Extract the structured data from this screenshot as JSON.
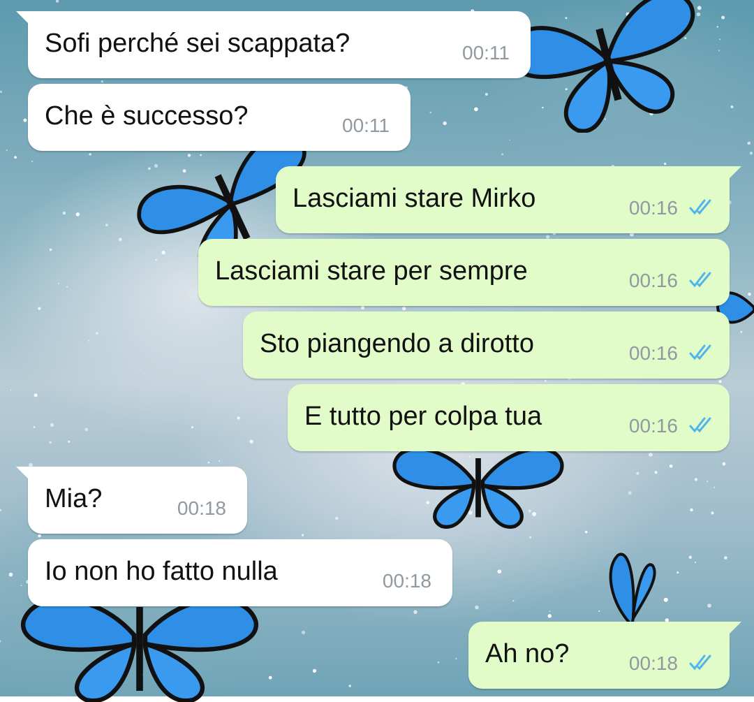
{
  "theme": {
    "incoming_bubble": "#ffffff",
    "outgoing_bubble": "#e2fcc9",
    "time_color": "#8f9aa0",
    "read_tick_color": "#4fb6ec",
    "butterfly_color": "#2f8fe6"
  },
  "messages": [
    {
      "direction": "incoming",
      "text": "Sofi perché sei scappata?",
      "time": "00:11"
    },
    {
      "direction": "incoming",
      "text": "Che è successo?",
      "time": "00:11"
    },
    {
      "direction": "outgoing",
      "text": "Lasciami stare Mirko",
      "time": "00:16",
      "status": "read"
    },
    {
      "direction": "outgoing",
      "text": "Lasciami stare per sempre",
      "time": "00:16",
      "status": "read"
    },
    {
      "direction": "outgoing",
      "text": "Sto piangendo a dirotto",
      "time": "00:16",
      "status": "read"
    },
    {
      "direction": "outgoing",
      "text": "E tutto per colpa tua",
      "time": "00:16",
      "status": "read"
    },
    {
      "direction": "incoming",
      "text": "Mia?",
      "time": "00:18"
    },
    {
      "direction": "incoming",
      "text": "Io non ho fatto nulla",
      "time": "00:18"
    },
    {
      "direction": "outgoing",
      "text": "Ah no?",
      "time": "00:18",
      "status": "read"
    }
  ]
}
